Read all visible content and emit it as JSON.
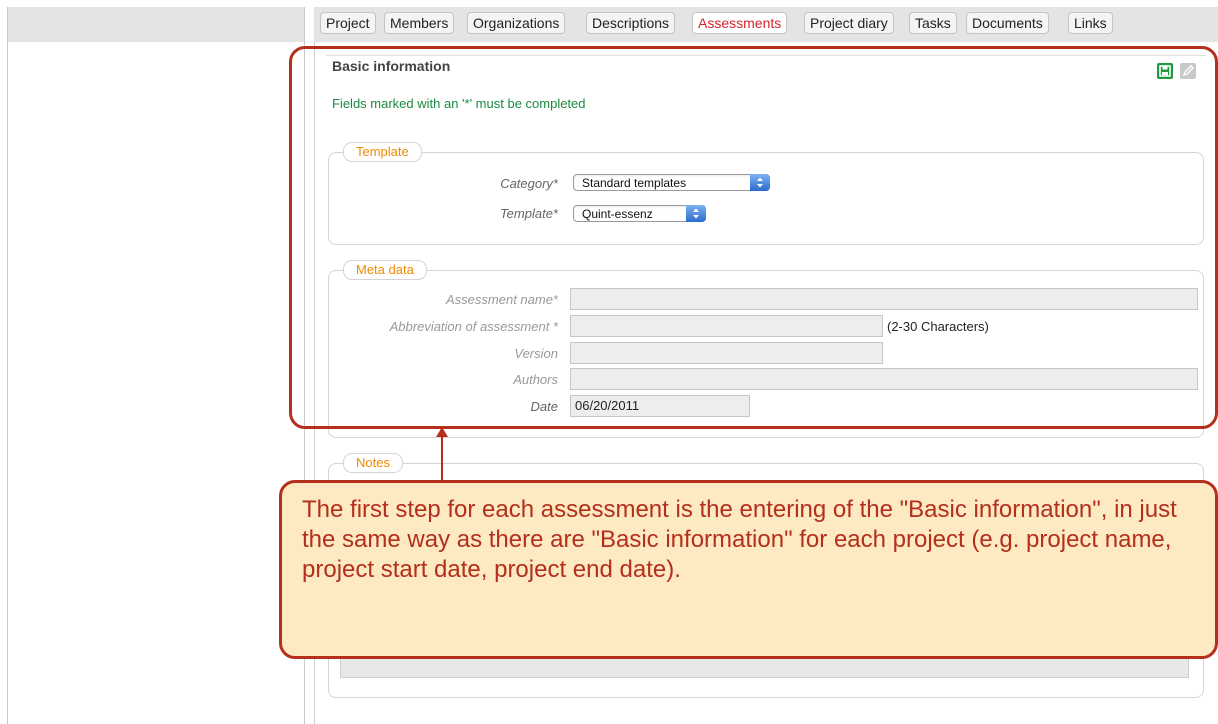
{
  "tabs": [
    "Project",
    "Members",
    "Organizations",
    "Descriptions",
    "Assessments",
    "Project diary",
    "Tasks",
    "Documents",
    "Links"
  ],
  "active_tab": "Assessments",
  "section": {
    "title": "Basic information",
    "required_note": "Fields marked with an '*' must be completed"
  },
  "template_box": {
    "legend": "Template",
    "category_label": "Category*",
    "category_value": "Standard templates",
    "template_label": "Template*",
    "template_value": "Quint-essenz"
  },
  "meta_box": {
    "legend": "Meta data",
    "assessment_name_label": "Assessment name*",
    "assessment_name_value": "",
    "abbreviation_label": "Abbreviation of assessment *",
    "abbreviation_value": "",
    "abbreviation_hint": "(2-30 Characters)",
    "version_label": "Version",
    "version_value": "",
    "authors_label": "Authors",
    "authors_value": "",
    "date_label": "Date",
    "date_value": "06/20/2011"
  },
  "notes_box": {
    "legend": "Notes"
  },
  "callout": {
    "text": "The first step for each assessment is the entering of the \"Basic information\", in just the same way as there are \"Basic information\" for each project (e.g. project name, project start date, project end date)."
  },
  "icons": {
    "save": "save-icon",
    "edit": "pencil-icon",
    "select_arrow": "up-down-arrows-icon"
  },
  "colors": {
    "active_tab": "#d8222e",
    "legend": "#f08a00",
    "required_note": "#1a8a3e",
    "callout_border": "#b42f1c",
    "callout_bg": "#fde9c2"
  }
}
